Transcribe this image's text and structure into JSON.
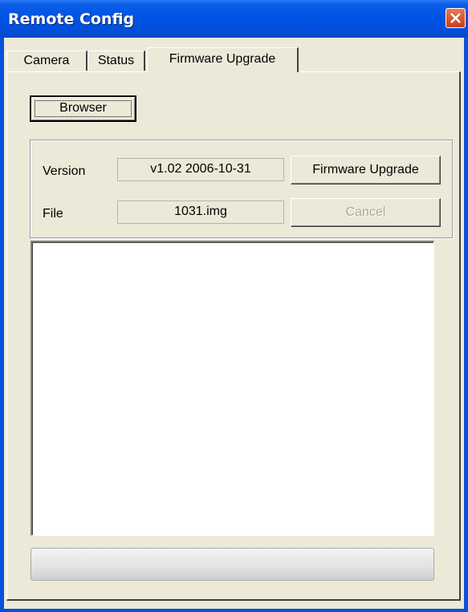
{
  "window": {
    "title": "Remote Config"
  },
  "tabs": [
    {
      "label": "Camera"
    },
    {
      "label": "Status"
    },
    {
      "label": "Firmware Upgrade",
      "active": true
    }
  ],
  "firmware": {
    "browser_button": "Browser",
    "version_label": "Version",
    "version_value": "v1.02 2006-10-31",
    "file_label": "File",
    "file_value": "1031.img",
    "upgrade_button": "Firmware Upgrade",
    "cancel_button": "Cancel",
    "cancel_enabled": false,
    "log_text": "",
    "progress": 0
  },
  "colors": {
    "titlebar": "#0054e3",
    "client_bg": "#ece9d8",
    "close_button": "#d95a36"
  }
}
